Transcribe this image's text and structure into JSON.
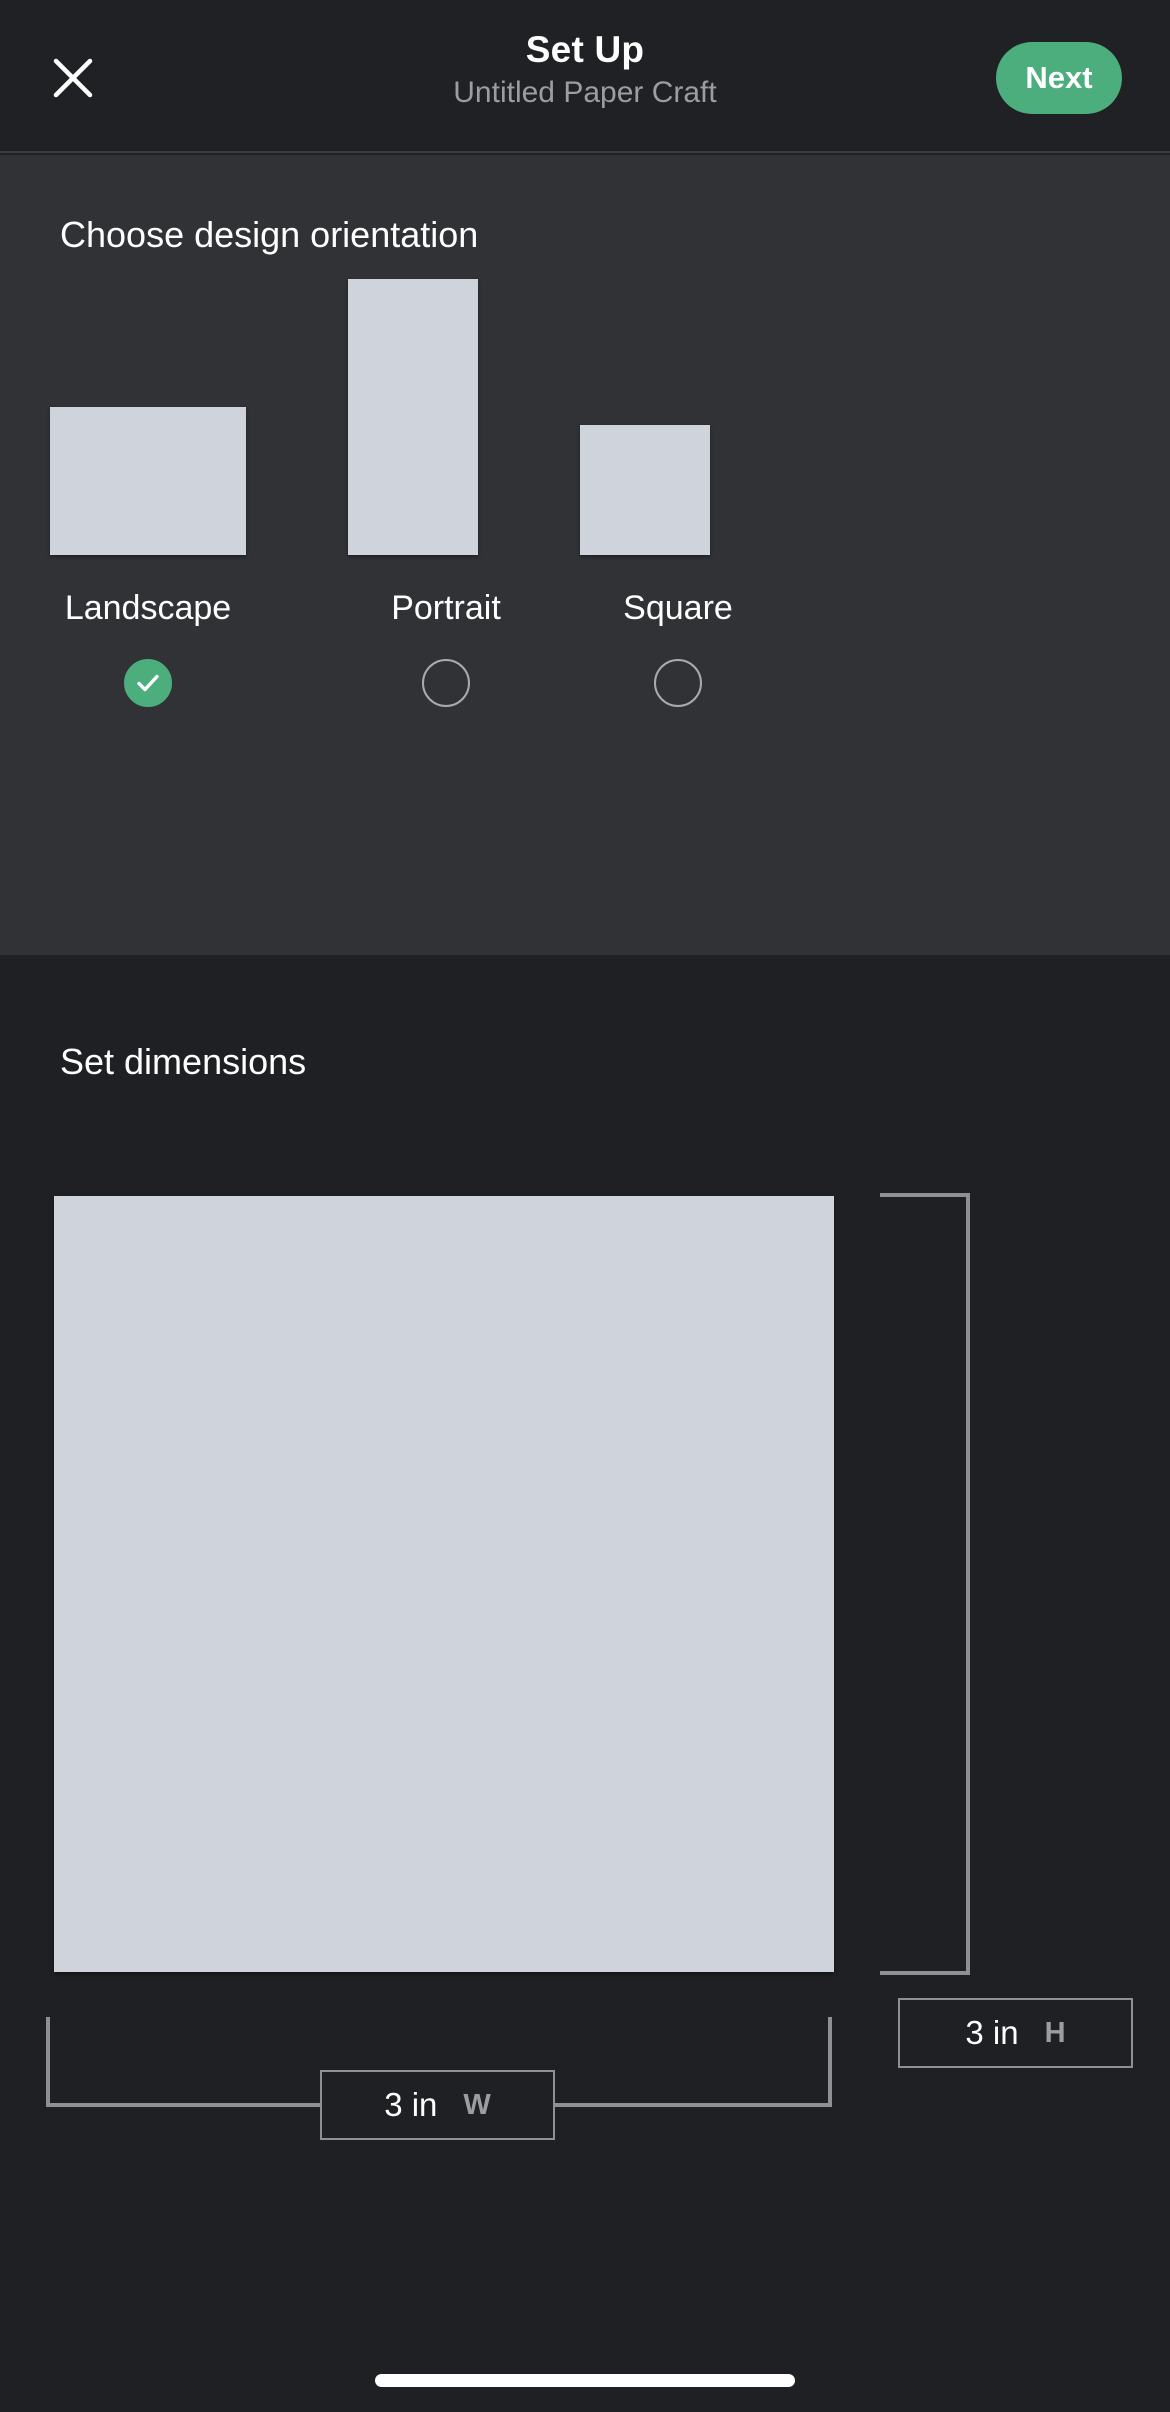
{
  "header": {
    "close_icon": "close-x-icon",
    "title": "Set Up",
    "subtitle": "Untitled Paper Craft",
    "next_label": "Next",
    "accent_color": "#4cad7d"
  },
  "orientation": {
    "heading": "Choose design orientation",
    "options": [
      {
        "label": "Landscape",
        "selected": true,
        "check_icon": "check-icon"
      },
      {
        "label": "Portrait",
        "selected": false,
        "check_icon": ""
      },
      {
        "label": "Square",
        "selected": false,
        "check_icon": ""
      }
    ]
  },
  "dimensions": {
    "heading": "Set dimensions",
    "height_field": {
      "value": "3 in",
      "unit_label": "H",
      "placeholder": "3 in"
    },
    "width_field": {
      "value": "3 in",
      "unit_label": "W",
      "placeholder": "3 in"
    },
    "shape_color": "#ced3dc",
    "guide_color": "#8e9094"
  },
  "system": {
    "home_indicator": "home-indicator"
  }
}
